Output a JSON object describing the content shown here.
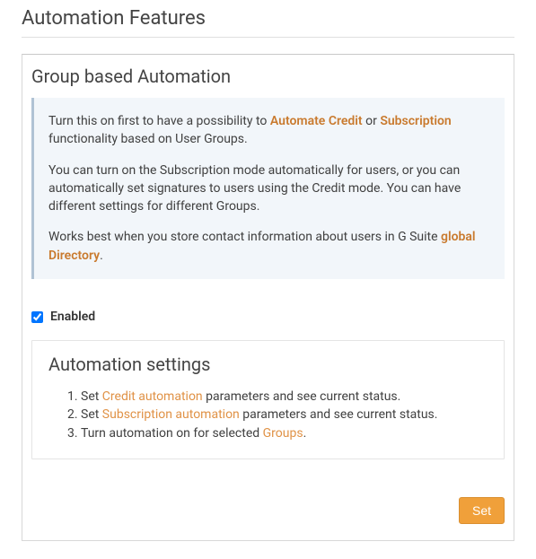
{
  "page": {
    "title": "Automation Features"
  },
  "panel": {
    "title": "Group based Automation"
  },
  "info": {
    "p1a": "Turn this on first to have a possibility to ",
    "link_automate_credit": "Automate Credit",
    "p1b": " or ",
    "link_subscription": "Subscription",
    "p1c": " functionality based on User Groups.",
    "p2": "You can turn on the Subscription mode automatically for users, or you can automatically set signatures to users using the Credit mode. You can have different settings for different Groups.",
    "p3a": "Works best when you store contact information about users in G Suite ",
    "link_global_directory": "global Directory",
    "p3b": "."
  },
  "enabled": {
    "label": "Enabled"
  },
  "settings": {
    "title": "Automation settings",
    "item1a": "Set ",
    "item1_link": "Credit automation",
    "item1b": " parameters and see current status.",
    "item2a": "Set ",
    "item2_link": "Subscription automation",
    "item2b": " parameters and see current status.",
    "item3a": "Turn automation on for selected ",
    "item3_link": "Groups",
    "item3b": "."
  },
  "footer": {
    "set_button": "Set"
  }
}
